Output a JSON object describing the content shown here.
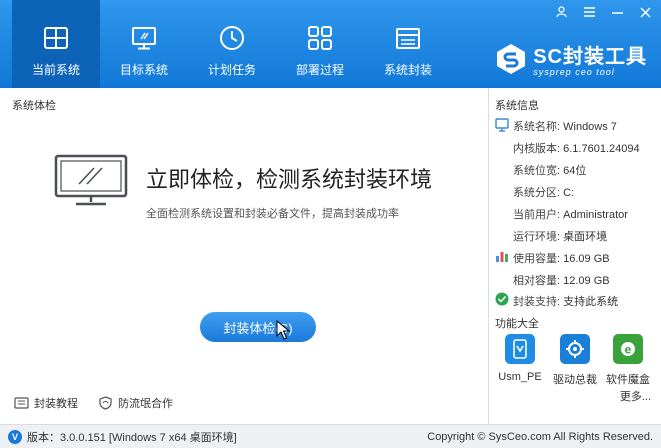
{
  "window": {
    "controls": {
      "user": "user-icon",
      "menu": "menu-icon",
      "minimize": "minimize-icon",
      "close": "close-icon"
    }
  },
  "nav": [
    {
      "label": "当前系统",
      "icon": "windows-icon",
      "active": true
    },
    {
      "label": "目标系统",
      "icon": "monitor-icon",
      "active": false
    },
    {
      "label": "计划任务",
      "icon": "clock-icon",
      "active": false
    },
    {
      "label": "部署过程",
      "icon": "grid-icon",
      "active": false
    },
    {
      "label": "系统封装",
      "icon": "package-icon",
      "active": false
    }
  ],
  "logo": {
    "title": "SC封装工具",
    "subtitle": "sysprep ceo tool"
  },
  "left": {
    "section_title": "系统体检",
    "heading": "立即体检，检测系统封装环境",
    "description": "全面检测系统设置和封装必备文件，提高封装成功率",
    "check_button": "封装体检(S)"
  },
  "bottom_links": [
    {
      "label": "封装教程",
      "icon": "book-icon"
    },
    {
      "label": "防流氓合作",
      "icon": "shield-icon"
    }
  ],
  "system_info": {
    "title": "系统信息",
    "rows": [
      {
        "key": "系统名称:",
        "value": "Windows 7"
      },
      {
        "key": "内核版本:",
        "value": "6.1.7601.24094"
      },
      {
        "key": "系统位宽:",
        "value": "64位"
      },
      {
        "key": "系统分区:",
        "value": "C:"
      },
      {
        "key": "当前用户:",
        "value": "Administrator"
      },
      {
        "key": "运行环境:",
        "value": "桌面环境"
      },
      {
        "key": "使用容量:",
        "value": "16.09 GB"
      },
      {
        "key": "相对容量:",
        "value": "12.09 GB"
      },
      {
        "key": "封装支持:",
        "value": "支持此系统"
      }
    ]
  },
  "tools": {
    "title": "功能大全",
    "items": [
      {
        "label": "Usm_PE",
        "icon": "usm-pe-icon",
        "color": "#1f8de6"
      },
      {
        "label": "驱动总裁",
        "icon": "driver-icon",
        "color": "#1a7fd8"
      },
      {
        "label": "软件魔盒",
        "icon": "software-box-icon",
        "color": "#3aa23a"
      }
    ],
    "more": "更多..."
  },
  "status": {
    "version": "版本：3.0.0.151 [Windows 7 x64 桌面环境]",
    "copyright": "Copyright © SysCeo.com All Rights Reserved."
  },
  "colors": {
    "accent": "#1a78d8",
    "nav_active": "#0d63b8",
    "ok": "#2ea44f"
  }
}
